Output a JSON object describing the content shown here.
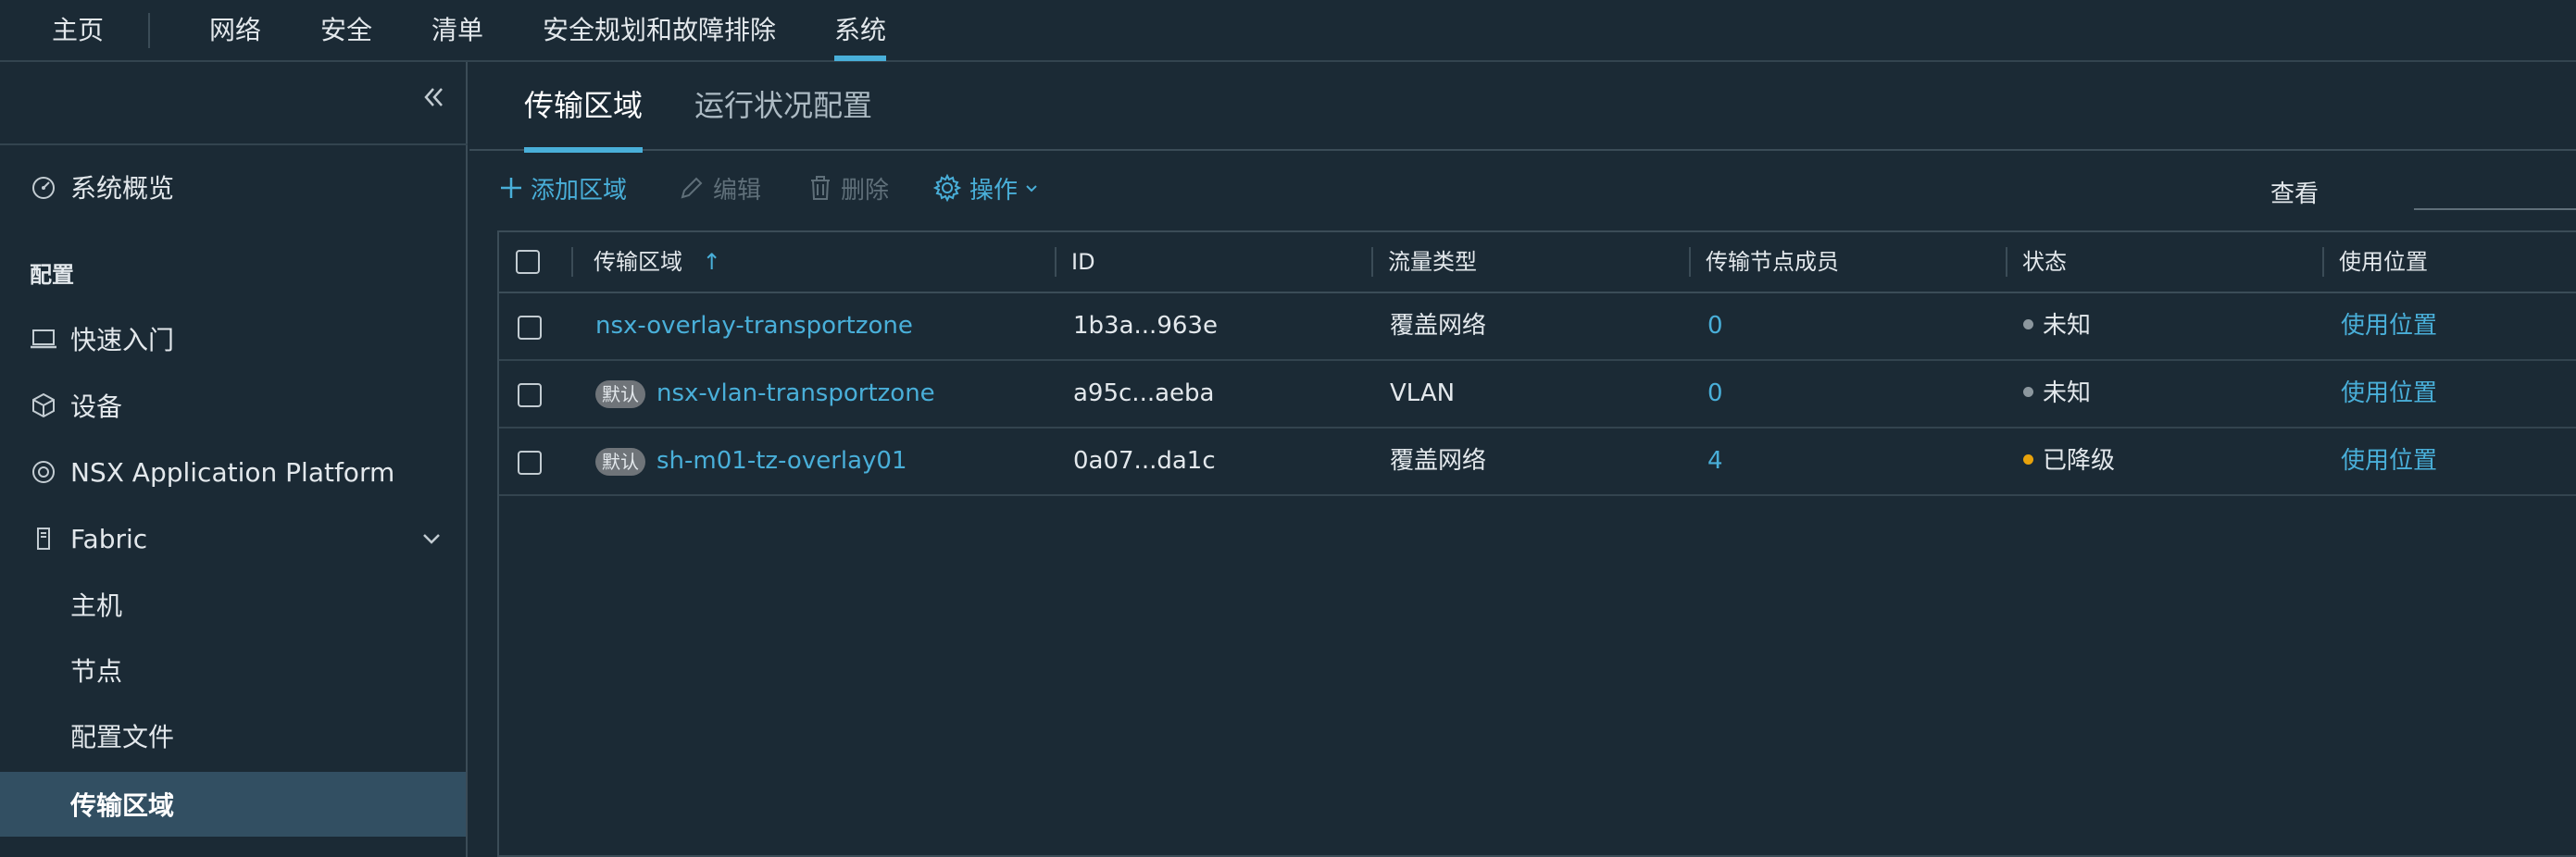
{
  "nav": {
    "items": [
      {
        "label": "主页"
      },
      {
        "label": "网络"
      },
      {
        "label": "安全"
      },
      {
        "label": "清单"
      },
      {
        "label": "安全规划和故障排除"
      },
      {
        "label": "系统"
      }
    ],
    "active": "系统"
  },
  "sidebar": {
    "overview_label": "系统概览",
    "section_label": "配置",
    "items": [
      {
        "label": "快速入门",
        "icon": "laptop-icon"
      },
      {
        "label": "设备",
        "icon": "cube-icon"
      },
      {
        "label": "NSX Application Platform",
        "icon": "platform-icon"
      },
      {
        "label": "Fabric",
        "icon": "fabric-icon"
      }
    ],
    "fabric_children": [
      {
        "label": "主机"
      },
      {
        "label": "节点"
      },
      {
        "label": "配置文件"
      },
      {
        "label": "传输区域"
      }
    ],
    "selected": "传输区域"
  },
  "tabs": [
    {
      "label": "传输区域"
    },
    {
      "label": "运行状况配置"
    }
  ],
  "toolbar": {
    "add_label": "添加区域",
    "edit_label": "编辑",
    "delete_label": "删除",
    "actions_label": "操作",
    "view_label": "查看"
  },
  "table": {
    "columns": [
      "传输区域",
      "ID",
      "流量类型",
      "传输节点成员",
      "状态",
      "使用位置"
    ],
    "sort_indicator": "↑",
    "rows": [
      {
        "badge": "",
        "name": "nsx-overlay-transportzone",
        "id": "1b3a...963e",
        "traffic": "覆盖网络",
        "members": "0",
        "status": "未知",
        "status_color": "#8c979e",
        "where_used": "使用位置"
      },
      {
        "badge": "默认",
        "name": "nsx-vlan-transportzone",
        "id": "a95c...aeba",
        "traffic": "VLAN",
        "members": "0",
        "status": "未知",
        "status_color": "#8c979e",
        "where_used": "使用位置"
      },
      {
        "badge": "默认",
        "name": "sh-m01-tz-overlay01",
        "id": "0a07...da1c",
        "traffic": "覆盖网络",
        "members": "4",
        "status": "已降级",
        "status_color": "#e8a20b",
        "where_used": "使用位置"
      }
    ]
  },
  "colors": {
    "accent": "#49afd9",
    "background": "#1b2a35",
    "selected_bg": "#324f62",
    "degraded": "#e8a20b",
    "unknown": "#8c979e"
  }
}
